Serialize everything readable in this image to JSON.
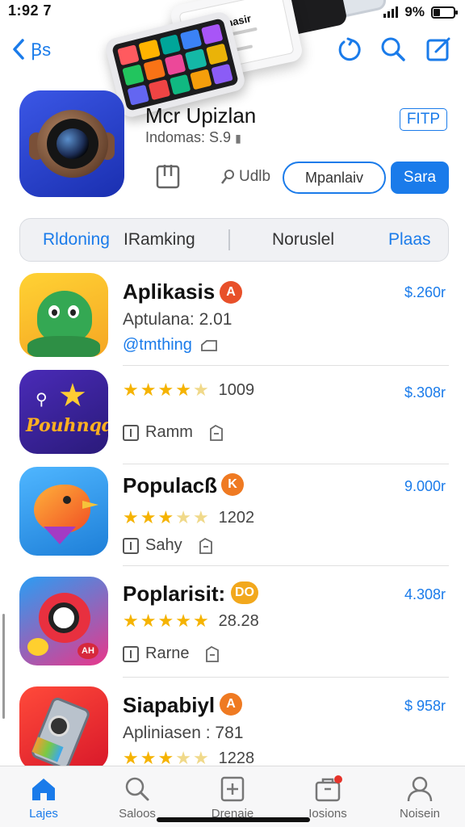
{
  "status": {
    "time": "1:92 7",
    "battery": "9%",
    "battery_level": 0.35
  },
  "nav": {
    "back_label": "Ꞵs",
    "icons": [
      "refresh-icon",
      "search-icon",
      "edit-icon"
    ]
  },
  "app": {
    "title": "Mcr Upizlan",
    "subtitle": "Indomas: S.9",
    "ftp_label": "FITP",
    "mini_tag": "Udlb",
    "outline_button": "Mpanlaiv",
    "fill_button": "Sara"
  },
  "tabs": [
    "Rldoning",
    "IRamking",
    "Noruslel",
    "Plaas"
  ],
  "list": [
    {
      "name": "Aplikasis",
      "badge": "A",
      "badge_color": "#e8502a",
      "price": "$.260r",
      "sub": "Aptulana: 2.01",
      "link": "@tmthing",
      "rating": 0,
      "count": "",
      "meta": ""
    },
    {
      "name": "",
      "badge": "",
      "badge_color": "",
      "price": "$.308r",
      "sub": "",
      "link": "",
      "rating": 4,
      "count": "1009",
      "meta": "Ramm"
    },
    {
      "name": "Populacß",
      "badge": "K",
      "badge_color": "#ef7a22",
      "price": "9.000r",
      "sub": "",
      "link": "",
      "rating": 3.5,
      "count": "1202",
      "meta": "Sahy"
    },
    {
      "name": "Poplarisit:",
      "badge": "DO",
      "badge_color": "#f2a81d",
      "price": "4.308r",
      "sub": "",
      "link": "",
      "rating": 5,
      "count": "28.28",
      "meta": "Rarne"
    },
    {
      "name": "Siapabiyl",
      "badge": "A",
      "badge_color": "#ef7a22",
      "price": "$ 958r",
      "sub": "Apliniasen : 781",
      "link": "",
      "rating": 3.5,
      "count": "1228",
      "meta": ""
    }
  ],
  "tabbar": [
    {
      "label": "Lajes",
      "icon": "home-icon",
      "active": true
    },
    {
      "label": "Saloos",
      "icon": "search-icon",
      "active": false
    },
    {
      "label": "Drenaie",
      "icon": "add-box-icon",
      "active": false
    },
    {
      "label": "Iosions",
      "icon": "bag-icon",
      "active": false
    },
    {
      "label": "Noisein",
      "icon": "person-icon",
      "active": false
    }
  ],
  "colors": {
    "accent": "#1a7bea",
    "star": "#f5b301"
  }
}
